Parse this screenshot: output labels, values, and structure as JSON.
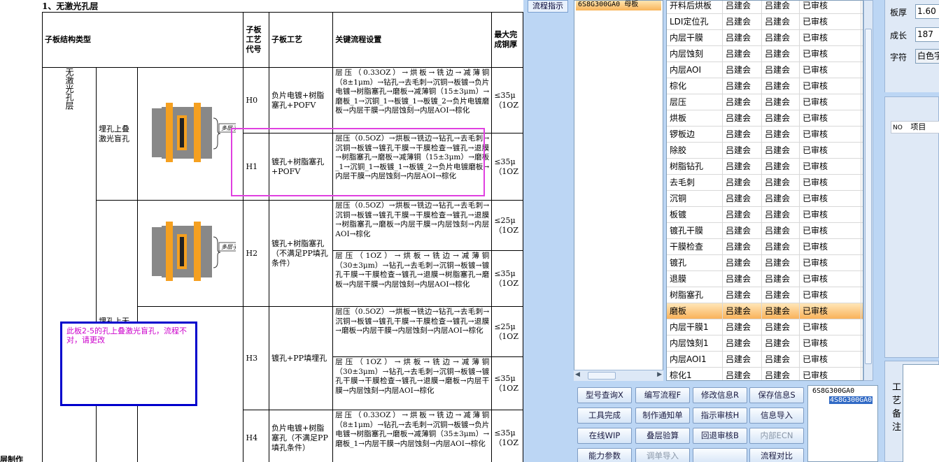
{
  "doc": {
    "heading": "1、无激光孔层",
    "headers": {
      "structure": "子板结构类型",
      "code": "子板工艺代号",
      "process": "子板工艺",
      "flow": "关键流程设置",
      "max": "最大完成铜厚"
    },
    "group_label": "无激光孔层",
    "struct_1": "埋孔上叠激光盲孔",
    "struct_2": "埋孔上无",
    "pcb_label": "多层子板",
    "rows": [
      {
        "code": "H0",
        "process": "负片电镀+树脂塞孔+POFV",
        "flow": "层压（0.33OZ）→烘板→铣边→减薄铜（8±1μm）→钻孔→去毛刺→沉铜→板镀→负片电镀→树脂塞孔→磨板→减薄铜（15±3μm）→磨板_1→沉铜_1→板镀_1→板镀_2→负片电镀磨板→内层干膜→内层蚀刻→内层AOI→棕化",
        "max": "≤35μ（1OZ"
      },
      {
        "code": "H1",
        "process": "镀孔+树脂塞孔+POFV",
        "flow": "层压（0.5OZ）→烘板→铣边→钻孔→去毛刺→沉铜→板镀→镀孔干膜→干膜检查→镀孔→退膜→树脂塞孔→磨板→减薄铜（15±3μm）→磨板_1→沉铜_1→板镀_1→板镀_2→负片电镀磨板→内层干膜→内层蚀刻→内层AOI→棕化",
        "max": "≤35μ（1OZ"
      },
      {
        "code": "H2",
        "process": "镀孔+树脂塞孔（不满足PP填孔条件）",
        "flow": "层压（0.5OZ）→烘板→铣边→钻孔→去毛刺→沉铜→板镀→镀孔干膜→干膜检查→镀孔→退膜→树脂塞孔→磨板→内层干膜→内层蚀刻→内层AOI→棕化",
        "max": "≤25μ（1OZ"
      },
      {
        "code": "",
        "process": "",
        "flow": "层压（1OZ）→烘板→铣边→减薄铜（30±3μm）→钻孔→去毛刺→沉铜→板镀→镀孔干膜→干膜检查→镀孔→退膜→树脂塞孔→磨板→内层干膜→内层蚀刻→内层AOI→棕化",
        "max": "≤35μ（1OZ"
      },
      {
        "code": "H3",
        "process": "镀孔+PP填埋孔",
        "flow": "层压（0.5OZ）→烘板→铣边→钻孔→去毛刺→沉铜→板镀→镀孔干膜→干膜检查→镀孔→退膜→磨板→内层干膜→内层蚀刻→内层AOI→棕化",
        "max": "≤25μ（1OZ"
      },
      {
        "code": "",
        "process": "",
        "flow": "层压（1OZ）→烘板→铣边→减薄铜（30±3μm）→钻孔→去毛刺→沉铜→板镀→镀孔干膜→干膜检查→镀孔→退膜→磨板→内层干膜→内层蚀刻→内层AOI→棕化",
        "max": "≤35μ（1OZ"
      },
      {
        "code": "H4",
        "process": "负片电镀+树脂塞孔（不满足PP填孔条件）",
        "flow": "层压（0.33OZ）→烘板→铣边→减薄铜（8±1μm）→钻孔→去毛刺→沉铜→板镀→负片电镀→树脂塞孔→磨板→减薄铜（35±3μm）→磨板_1→内层干膜→内层蚀刻→内层AOI→棕化",
        "max": "≤35μ（1OZ"
      }
    ],
    "comment": "此板2-5的孔上叠激光盲孔，流程不对，请更改",
    "footer": "层制作"
  },
  "app": {
    "flow_tab": "流程指示",
    "left_selected": "6S8G300GA0  母板",
    "grid_rows": [
      [
        "开料后烘板",
        "吕建会",
        "吕建会",
        "已审核"
      ],
      [
        "LDI定位孔",
        "吕建会",
        "吕建会",
        "已审核"
      ],
      [
        "内层干膜",
        "吕建会",
        "吕建会",
        "已审核"
      ],
      [
        "内层蚀刻",
        "吕建会",
        "吕建会",
        "已审核"
      ],
      [
        "内层AOI",
        "吕建会",
        "吕建会",
        "已审核"
      ],
      [
        "棕化",
        "吕建会",
        "吕建会",
        "已审核"
      ],
      [
        "层压",
        "吕建会",
        "吕建会",
        "已审核"
      ],
      [
        "烘板",
        "吕建会",
        "吕建会",
        "已审核"
      ],
      [
        "锣板边",
        "吕建会",
        "吕建会",
        "已审核"
      ],
      [
        "除胶",
        "吕建会",
        "吕建会",
        "已审核"
      ],
      [
        "树脂钻孔",
        "吕建会",
        "吕建会",
        "已审核"
      ],
      [
        "去毛刺",
        "吕建会",
        "吕建会",
        "已审核"
      ],
      [
        "沉铜",
        "吕建会",
        "吕建会",
        "已审核"
      ],
      [
        "板镀",
        "吕建会",
        "吕建会",
        "已审核"
      ],
      [
        "镀孔干膜",
        "吕建会",
        "吕建会",
        "已审核"
      ],
      [
        "干膜检查",
        "吕建会",
        "吕建会",
        "已审核"
      ],
      [
        "镀孔",
        "吕建会",
        "吕建会",
        "已审核"
      ],
      [
        "退膜",
        "吕建会",
        "吕建会",
        "已审核"
      ],
      [
        "树脂塞孔",
        "吕建会",
        "吕建会",
        "已审核"
      ],
      [
        "磨板",
        "吕建会",
        "吕建会",
        "已审核"
      ],
      [
        "内层干膜1",
        "吕建会",
        "吕建会",
        "已审核"
      ],
      [
        "内层蚀刻1",
        "吕建会",
        "吕建会",
        "已审核"
      ],
      [
        "内层AOI1",
        "吕建会",
        "吕建会",
        "已审核"
      ],
      [
        "棕化1",
        "吕建会",
        "吕建会",
        "已审核"
      ]
    ],
    "selected_row": 19,
    "buttons": [
      {
        "label": "型号查询X",
        "name": "model-query-button",
        "disabled": false
      },
      {
        "label": "编写流程F",
        "name": "write-flow-button",
        "disabled": false
      },
      {
        "label": "修改信息R",
        "name": "modify-info-button",
        "disabled": false
      },
      {
        "label": "保存信息S",
        "name": "save-info-button",
        "disabled": false
      },
      {
        "label": "工具完成",
        "name": "tool-complete-button",
        "disabled": false
      },
      {
        "label": "制作通知单",
        "name": "make-notice-button",
        "disabled": false
      },
      {
        "label": "指示审核H",
        "name": "instruction-audit-button",
        "disabled": false
      },
      {
        "label": "信息导入",
        "name": "info-import-button",
        "disabled": false
      },
      {
        "label": "在线WIP",
        "name": "online-wip-button",
        "disabled": false
      },
      {
        "label": "叠层验算",
        "name": "stackup-check-button",
        "disabled": false
      },
      {
        "label": "回退审核B",
        "name": "rollback-audit-button",
        "disabled": false
      },
      {
        "label": "内部ECN",
        "name": "internal-ecn-button",
        "disabled": true
      },
      {
        "label": "能力参数",
        "name": "capability-params-button",
        "disabled": false
      },
      {
        "label": "调单导入",
        "name": "order-import-button",
        "disabled": true
      },
      {
        "label": "",
        "name": "blank-button",
        "disabled": false
      },
      {
        "label": "流程对比",
        "name": "flow-compare-button",
        "disabled": false
      }
    ],
    "tree": {
      "root": "6S8G300GA0",
      "child": "4S8G300GA0"
    },
    "right": {
      "thickness_label": "板厚",
      "thickness_value": "1.60",
      "growth_label": "成长",
      "growth_value": "187",
      "char_label": "字符",
      "char_value": "白色字",
      "col_no": "NO",
      "col_item": "项目",
      "remark_label": "工艺备注"
    }
  }
}
